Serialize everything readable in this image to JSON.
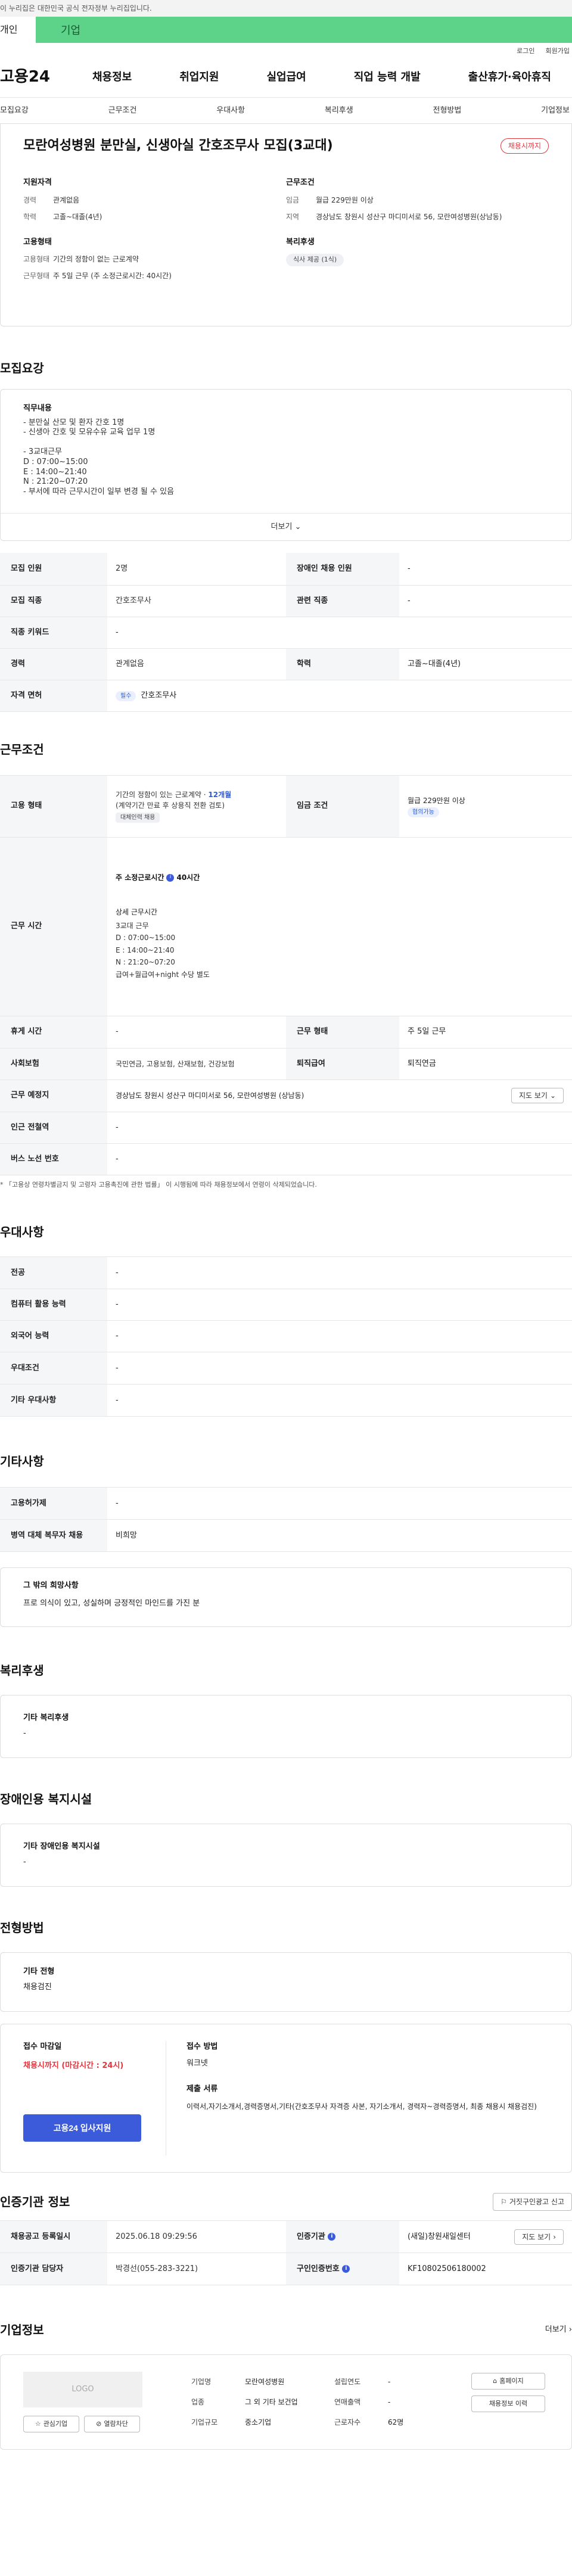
{
  "notice": "이 누리집은 대한민국 공식 전자정부 누리집입니다.",
  "top_tabs": [
    "개인",
    "기업"
  ],
  "util": [
    "로그인",
    "회원가입"
  ],
  "logo": "고용24",
  "gnb": [
    "채용정보",
    "취업지원",
    "실업급여",
    "직업 능력 개발",
    "출산휴가·육아휴직"
  ],
  "anchors": [
    "모집요강",
    "근무조건",
    "우대사항",
    "복리후생",
    "전형방법",
    "기업정보"
  ],
  "job": {
    "title": "모란여성병원 분만실, 신생아실 간호조무사 모집(3교대)",
    "badge": "채용시까지",
    "qual_h": "지원자격",
    "career_k": "경력",
    "career_v": "관계없음",
    "edu_k": "학력",
    "edu_v": "고졸~대졸(4년)",
    "emp_h": "고용형태",
    "emp_v": "기간의 정함이 없는 근로계약",
    "worktype_k": "근무형태",
    "worktype_v": "주 5일 근무 (주 소정근로시간: 40시간)",
    "cond_h": "근무조건",
    "wage_k": "임금",
    "wage_v": "월급 229만원 이상",
    "loc_k": "지역",
    "loc_v": "경상남도 창원시 성산구 마디미서로 56, 모란여성병원(상남동)",
    "ben_h": "복리후생",
    "ben_chip": "식사 제공 (1식)"
  },
  "recruit": {
    "title": "모집요강",
    "duty_h": "직무내용",
    "duty": "- 분만실 산모 및 환자 간호 1명\n- 신생아 간호 및 모유수유 교육 업무 1명\n\n- 3교대근무\n  D : 07:00~15:00\n  E : 14:00~21:40\n  N : 21:20~07:20\n- 부서에 따라 근무시간이 일부 변경 될 수 있음",
    "more": "더보기",
    "rows": [
      [
        "모집 인원",
        "2명",
        "장애인 채용 인원",
        "-"
      ],
      [
        "모집 직종",
        "간호조무사",
        "관련 직종",
        "-"
      ],
      [
        "직종 키워드",
        "-"
      ],
      [
        "경력",
        "관계없음",
        "학력",
        "고졸~대졸(4년)"
      ]
    ],
    "license_k": "자격 면허",
    "license_tag": "필수",
    "license_v": "간호조무사"
  },
  "work": {
    "title": "근무조건",
    "emp_k": "고용 형태",
    "emp_v1": "기간의 정함이 있는 근로계약 · ",
    "emp_period": "12개월",
    "emp_v2": "(계약기간 만료 후 상용직 전환 검토)",
    "emp_tag": "대체인력 채용",
    "wage_k": "임금 조건",
    "wage_v": "월급 229만원 이상",
    "wage_tag": "협의가능",
    "time_k": "근무 시간",
    "time_v1": "주 소정근로시간",
    "time_v1b": "40시간",
    "time_h": "상세 근무시간",
    "time_detail": "3교대 근무\nD : 07:00~15:00\nE : 14:00~21:40\nN : 21:20~07:20\n급여+월급여+night 수당 별도",
    "rows": [
      [
        "휴게 시간",
        "-",
        "근무 형태",
        "주 5일 근무"
      ],
      [
        "사회보험",
        "국민연금, 고용보험, 산재보험, 건강보험",
        "퇴직급여",
        "퇴직연금"
      ]
    ],
    "place_k": "근무 예정지",
    "place_v": "경상남도 창원시 성산구 마디미서로 56, 모란여성병원 (상남동)",
    "map_btn": "지도 보기",
    "rows2": [
      [
        "인근 전철역",
        "-"
      ],
      [
        "버스 노선 번호",
        "-"
      ]
    ],
    "footnote": "* 「고용상 연령차별금지 및 고령자 고용촉진에 관한 법률」 이 시행됨에 따라 채용정보에서 연령이 삭제되었습니다."
  },
  "pref": {
    "title": "우대사항",
    "rows": [
      [
        "전공",
        "-"
      ],
      [
        "컴퓨터 활용 능력",
        "-"
      ],
      [
        "외국어 능력",
        "-"
      ],
      [
        "우대조건",
        "-"
      ],
      [
        "기타 우대사항",
        "-"
      ]
    ]
  },
  "etc": {
    "title": "기타사항",
    "rows": [
      [
        "고용허가제",
        "-"
      ],
      [
        "병역 대체 복무자 채용",
        "비희망"
      ]
    ],
    "wish_h": "그 밖의 희망사항",
    "wish_v": "프로 의식이 있고, 성실하며 긍정적인 마인드를 가진 분"
  },
  "welfare": {
    "title": "복리후생",
    "h": "기타 복리후생",
    "v": "-"
  },
  "disab": {
    "title": "장애인용 복지시설",
    "h": "기타 장애인용 복지시설",
    "v": "-"
  },
  "sel": {
    "title": "전형방법",
    "h": "기타 전형",
    "v": "채용검진",
    "deadline_h": "접수 마감일",
    "deadline_v": "채용시까지 (마감시간 : 24시)",
    "apply_btn": "고용24 입사지원",
    "method_h": "접수 방법",
    "method_v": "워크넷",
    "docs_h": "제출 서류",
    "docs_v": "이력서,자기소개서,경력증명서,기타(간호조무사 자격증 사본, 자기소개서, 경력자~경력증명서, 최종 채용시 채용검진)"
  },
  "agency": {
    "title": "인증기관 정보",
    "report_btn": "거짓구인광고 신고",
    "reg_k": "채용공고 등록일시",
    "reg_v": "2025.06.18 09:29:56",
    "org_k": "인증기관",
    "org_v": "(새일)창원새일센터",
    "map_btn": "지도 보기",
    "mgr_k": "인증기관 담당자",
    "mgr_v": "박경선(055-283-3221)",
    "no_k": "구인인증번호",
    "no_v": "KF10802506180002"
  },
  "company": {
    "title": "기업정보",
    "more": "더보기",
    "logo": "LOGO",
    "fav": "관심기업",
    "block": "열람차단",
    "rows": [
      [
        "기업명",
        "모란여성병원",
        "설립연도",
        "-"
      ],
      [
        "업종",
        "그 외 기타 보건업",
        "연매출액",
        "-"
      ],
      [
        "기업규모",
        "중소기업",
        "근로자수",
        "62명"
      ]
    ],
    "home_btn": "홈페이지",
    "list_btn": "채용정보 이력"
  },
  "colors": {
    "accent": "#3b5bdb",
    "tab_green": "#5dd38a",
    "badge_red": "#e0373f"
  }
}
